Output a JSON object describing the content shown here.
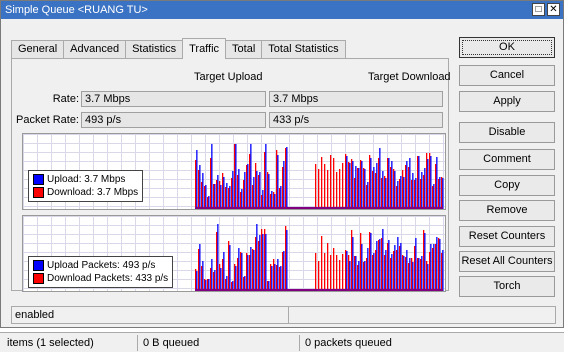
{
  "window": {
    "title": "Simple Queue <RUANG TU>",
    "close_glyph": "✕",
    "restore_glyph": "□"
  },
  "tabs": [
    "General",
    "Advanced",
    "Statistics",
    "Traffic",
    "Total",
    "Total Statistics"
  ],
  "active_tab": "Traffic",
  "columns": {
    "upload": "Target Upload",
    "download": "Target Download"
  },
  "rate": {
    "label": "Rate:",
    "upload": "3.7 Mbps",
    "download": "3.7 Mbps"
  },
  "packet_rate": {
    "label": "Packet Rate:",
    "upload": "493 p/s",
    "download": "433 p/s"
  },
  "bandwidth_graph": {
    "legend": [
      {
        "label": "Upload:  3.7 Mbps",
        "color": "#0000ff"
      },
      {
        "label": "Download:  3.7 Mbps",
        "color": "#ff0000"
      }
    ]
  },
  "packet_graph": {
    "legend": [
      {
        "label": "Upload Packets:  493 p/s",
        "color": "#0000ff"
      },
      {
        "label": "Download Packets:  433 p/s",
        "color": "#ff0000"
      }
    ]
  },
  "buttons": [
    "OK",
    "Cancel",
    "Apply",
    "Disable",
    "Comment",
    "Copy",
    "Remove",
    "Reset Counters",
    "Reset All Counters",
    "Torch"
  ],
  "status": {
    "state": "enabled"
  },
  "footer": {
    "items": "items (1 selected)",
    "bytes_queued": "0 B queued",
    "packets_queued": "0 packets queued"
  }
}
